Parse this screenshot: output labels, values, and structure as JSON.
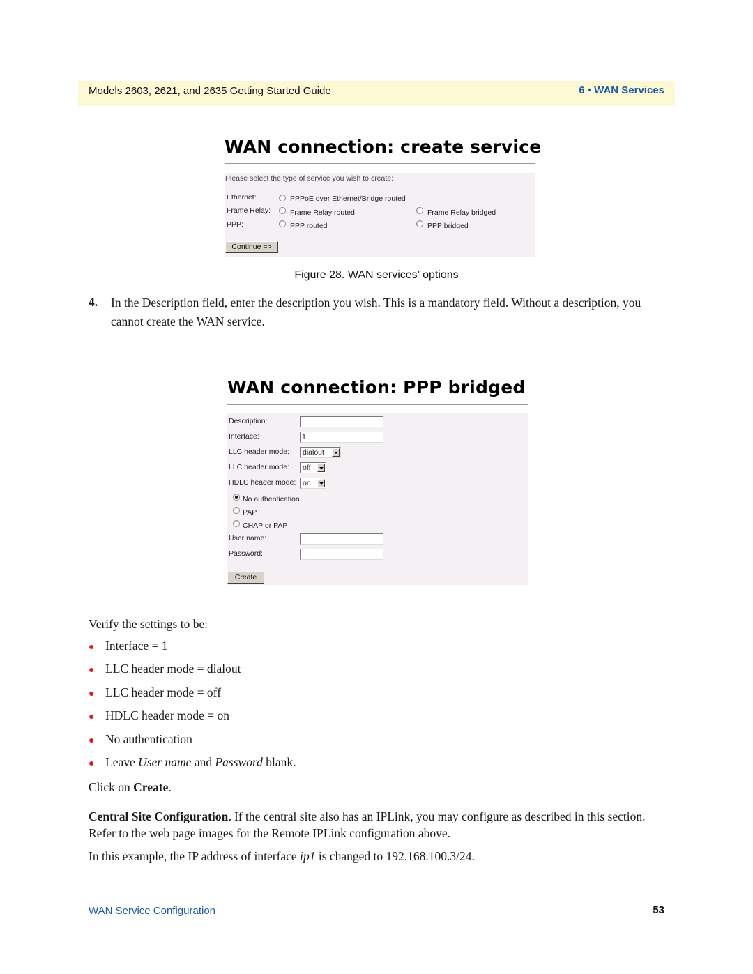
{
  "header": {
    "guide_title": "Models 2603, 2621, and 2635 Getting Started Guide",
    "chapter": "6 • WAN Services"
  },
  "figure1": {
    "title": "WAN connection: create service",
    "prompt": "Please select the type of service you wish to create:",
    "rows": [
      {
        "label": "Ethernet:",
        "options": [
          "PPPoE over Ethernet/Bridge routed"
        ]
      },
      {
        "label": "Frame Relay:",
        "options": [
          "Frame Relay routed",
          "Frame Relay bridged"
        ]
      },
      {
        "label": "PPP:",
        "options": [
          "PPP routed",
          "PPP bridged"
        ]
      }
    ],
    "continue_label": "Continue =>",
    "caption": "Figure 28. WAN services’ options"
  },
  "step4": {
    "number": "4.",
    "text": "In the Description field, enter the description you wish. This is a mandatory field. Without a description, you cannot create the WAN service."
  },
  "figure2": {
    "title": "WAN connection: PPP bridged",
    "fields": {
      "description_label": "Description:",
      "description_value": "",
      "interface_label": "Interface:",
      "interface_value": "1",
      "llc1_label": "LLC header mode:",
      "llc1_value": "dialout",
      "llc2_label": "LLC header mode:",
      "llc2_value": "off",
      "hdlc_label": "HDLC header mode:",
      "hdlc_value": "on"
    },
    "auth_options": [
      {
        "label": "No authentication",
        "checked": true
      },
      {
        "label": "PAP",
        "checked": false
      },
      {
        "label": "CHAP or PAP",
        "checked": false
      }
    ],
    "username_label": "User name:",
    "username_value": "",
    "password_label": "Password:",
    "password_value": "",
    "create_label": "Create"
  },
  "verify": {
    "intro": "Verify the settings to be:",
    "bullets": [
      "Interface = 1",
      "LLC header mode = dialout",
      "LLC header mode = off",
      "HDLC header mode = on",
      "No authentication"
    ],
    "leave_prefix": "Leave ",
    "leave_user": "User name",
    "leave_and": " and ",
    "leave_pass": "Password",
    "leave_suffix": " blank.",
    "click_prefix": "Click on ",
    "click_bold": "Create",
    "click_suffix": "."
  },
  "central": {
    "heading": "Central Site Configuration.",
    "text": " If the central site also has an IPLink, you may configure as described in this section. Refer to the web page images for the Remote IPLink configuration above.",
    "example_prefix": "In this example, the IP address of interface ",
    "example_iface": "ip1",
    "example_suffix": " is changed to 192.168.100.3/24."
  },
  "footer": {
    "section": "WAN Service Configuration",
    "page": "53"
  }
}
